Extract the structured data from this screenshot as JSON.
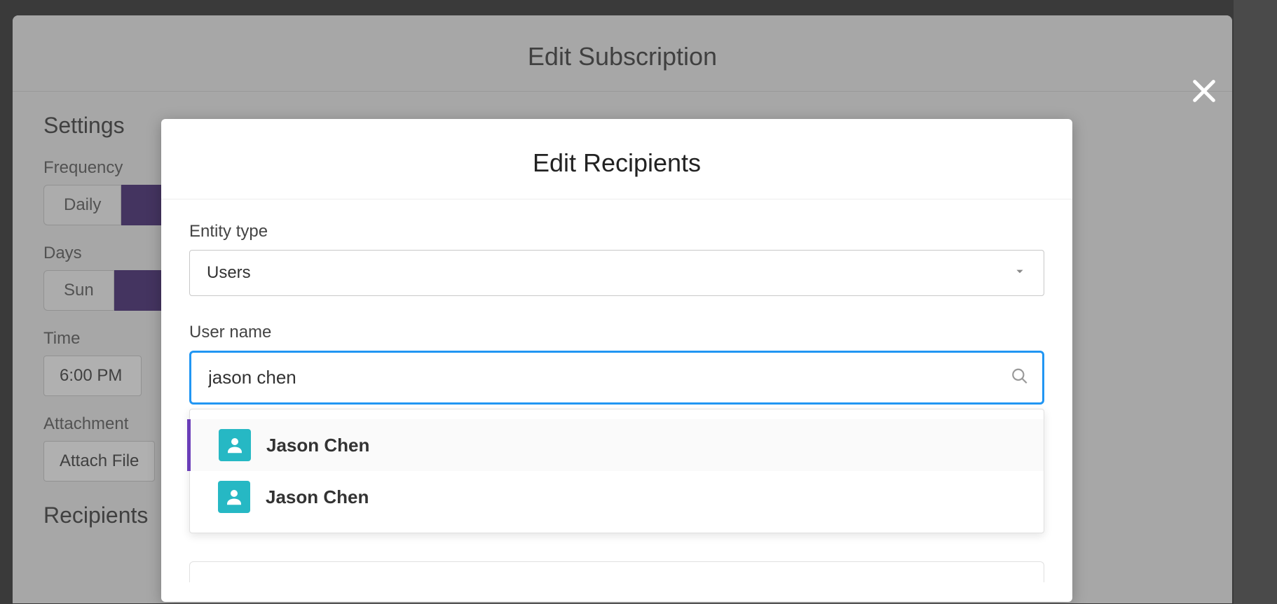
{
  "edit_subscription": {
    "title": "Edit Subscription",
    "settings_heading": "Settings",
    "frequency": {
      "label": "Frequency",
      "options": [
        "Daily"
      ],
      "selected_index_active": 1
    },
    "days": {
      "label": "Days",
      "options": [
        "Sun"
      ],
      "selected_index_active": 1
    },
    "time": {
      "label": "Time",
      "value": "6:00 PM"
    },
    "attachment": {
      "label": "Attachment",
      "button": "Attach File"
    },
    "recipients_heading": "Recipients"
  },
  "edit_recipients": {
    "title": "Edit Recipients",
    "entity_type": {
      "label": "Entity type",
      "selected": "Users"
    },
    "user_name": {
      "label": "User name",
      "value": "jason chen"
    },
    "results": [
      {
        "name": "Jason Chen",
        "highlight": true
      },
      {
        "name": "Jason Chen",
        "highlight": false
      }
    ]
  }
}
